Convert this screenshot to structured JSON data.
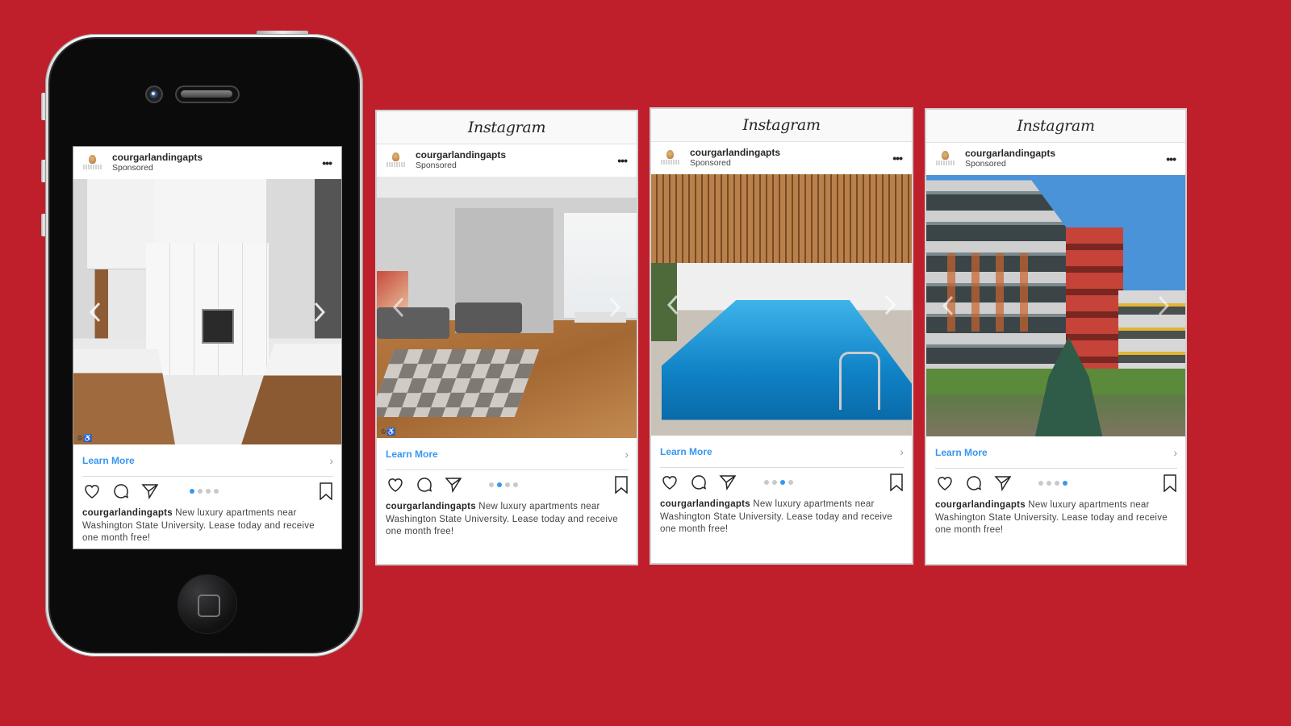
{
  "background_color": "#bf1f2b",
  "accent_color": "#3897f0",
  "app_name": "Instagram",
  "post": {
    "username": "courgarlandingapts",
    "sponsored_label": "Sponsored",
    "more_icon": "more-dots-icon",
    "cta_label": "Learn More",
    "cta_chevron": "›",
    "caption_user": "courgarlandingapts",
    "caption_text": " New luxury apartments near Washington State University. Lease today and receive one month free!",
    "accessibility_badge": "♔♿",
    "carousel_count": 4
  },
  "slides": [
    {
      "scene": "kitchen",
      "active_index": 1,
      "frame": "phone"
    },
    {
      "scene": "living-room",
      "active_index": 2,
      "frame": "card"
    },
    {
      "scene": "indoor-pool",
      "active_index": 3,
      "frame": "card"
    },
    {
      "scene": "apartment-building",
      "active_index": 4,
      "frame": "card"
    }
  ],
  "icons": [
    "heart-icon",
    "comment-icon",
    "share-icon",
    "bookmark-icon",
    "chevron-left-icon",
    "chevron-right-icon"
  ]
}
